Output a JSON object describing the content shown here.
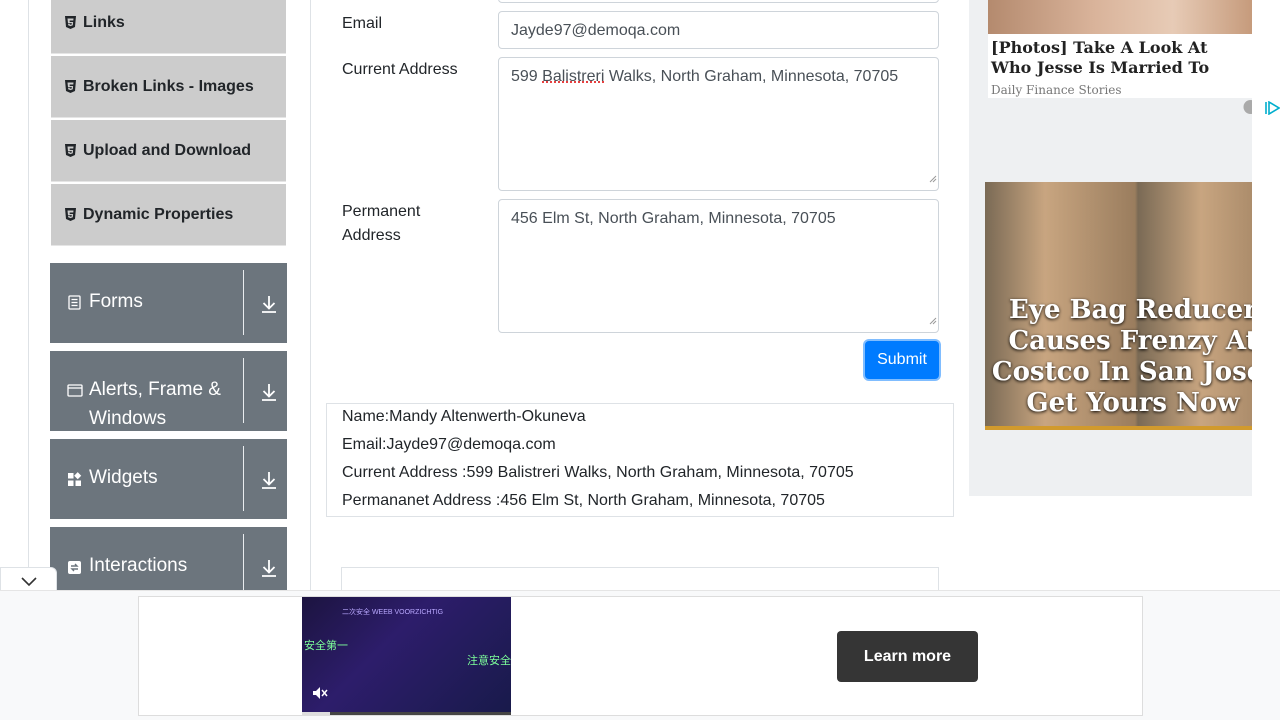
{
  "sidebar": {
    "items": [
      {
        "label": "Links"
      },
      {
        "label": "Broken Links - Images"
      },
      {
        "label": "Upload and Download"
      },
      {
        "label": "Dynamic Properties"
      }
    ],
    "groups": [
      {
        "label_line1": "Forms",
        "label_line2": ""
      },
      {
        "label_line1": "Alerts, Frame &",
        "label_line2": "Windows"
      },
      {
        "label_line1": "Widgets",
        "label_line2": ""
      },
      {
        "label_line1": "Interactions",
        "label_line2": ""
      }
    ]
  },
  "form": {
    "email_label": "Email",
    "email_value": "Jayde97@demoqa.com",
    "current_address_label": "Current Address",
    "current_address_value_spellcheck": "Balistreri",
    "current_address_prefix": "599 ",
    "current_address_suffix": " Walks, North Graham, Minnesota, 70705",
    "permanent_address_label_line1": "Permanent",
    "permanent_address_label_line2": "Address",
    "permanent_address_value": "456 Elm St, North Graham, Minnesota, 70705",
    "submit_label": "Submit"
  },
  "output": {
    "name": "Name:Mandy Altenwerth-Okuneva",
    "email": "Email:Jayde97@demoqa.com",
    "current_address": "Current Address :599 Balistreri Walks, North Graham, Minnesota, 70705",
    "permanent_address": "Permananet Address :456 Elm St, North Graham, Minnesota, 70705"
  },
  "side_ad": {
    "headline": "[Photos] Take A Look At Who Jesse Is Married To",
    "source": "Daily Finance Stories",
    "banner_text": "Eye Bag Reducer Causes Frenzy At Costco In San Jose- Get Yours Now"
  },
  "bottom_ad": {
    "cta_label": "Learn more",
    "video_lines": [
      "二次安全 WEEB VOORZICHTIG",
      "安全第一",
      "注意安全"
    ]
  },
  "colors": {
    "primary": "#007bff",
    "sidebar_group": "#6c757d",
    "sidebar_item": "#cccccc"
  }
}
